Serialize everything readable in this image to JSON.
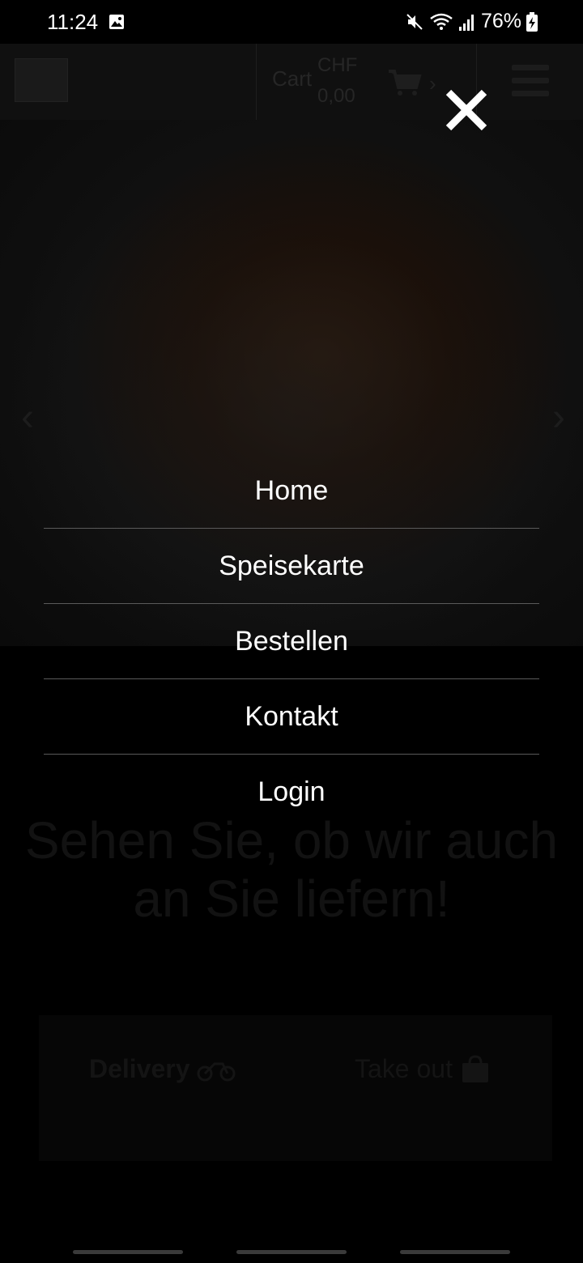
{
  "status_bar": {
    "time": "11:24",
    "battery_percent": "76%",
    "icons": [
      "image-icon",
      "mute-icon",
      "wifi-icon",
      "signal-icon",
      "battery-charging-icon"
    ]
  },
  "header": {
    "cart_label": "Cart",
    "cart_currency": "CHF",
    "cart_amount": "0,00"
  },
  "hero": {
    "prev_arrow": "‹",
    "next_arrow": "›"
  },
  "main": {
    "tagline": "Sehen Sie, ob wir auch an Sie liefern!",
    "delivery_label": "Delivery",
    "takeout_label": "Take out"
  },
  "menu": {
    "close_icon": "×",
    "items": [
      {
        "label": "Home"
      },
      {
        "label": "Speisekarte"
      },
      {
        "label": "Bestellen"
      },
      {
        "label": "Kontakt"
      },
      {
        "label": "Login"
      }
    ]
  },
  "colors": {
    "overlay_bg": "#000000",
    "menu_text": "#ffffff",
    "divider": "#5a5a5a"
  }
}
